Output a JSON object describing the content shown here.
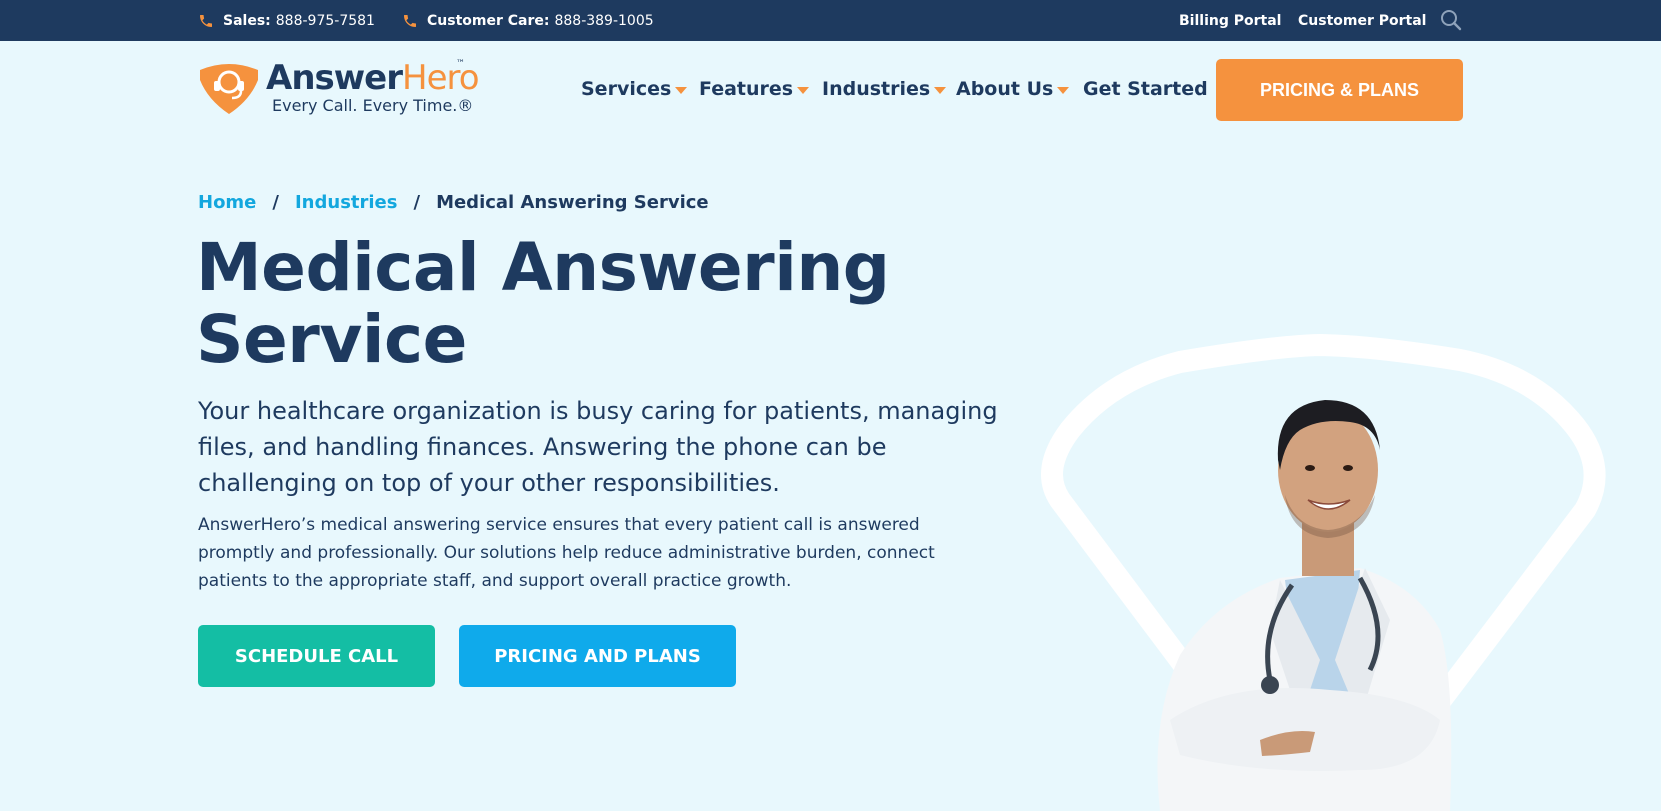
{
  "topbar": {
    "sales_label": "Sales:",
    "sales_number": "888-975-7581",
    "care_label": "Customer Care:",
    "care_number": "888-389-1005",
    "billing_portal": "Billing Portal",
    "customer_portal": "Customer Portal"
  },
  "logo": {
    "brand_main": "Answer",
    "brand_accent": "Hero",
    "trademark": "™",
    "tagline": "Every Call. Every Time.®"
  },
  "nav": {
    "items": [
      {
        "label": "Services"
      },
      {
        "label": "Features"
      },
      {
        "label": "Industries"
      },
      {
        "label": "About Us"
      },
      {
        "label": "Get Started"
      }
    ],
    "pricing_button": "PRICING & PLANS"
  },
  "breadcrumb": {
    "home": "Home",
    "industries": "Industries",
    "current": "Medical Answering Service",
    "separator": "/"
  },
  "hero": {
    "title_line1": "Medical Answering",
    "title_line2": "Service",
    "lead": "Your healthcare organization is busy caring for patients, managing files, and handling finances. Answering the phone can be challenging on top of your other responsibilities.",
    "body": "AnswerHero’s medical answering service ensures that every patient call is answered promptly and professionally. Our solutions help reduce administrative burden, connect patients to the appropriate staff, and support overall practice growth.",
    "schedule_button": "SCHEDULE CALL",
    "pricing_button": "PRICING AND PLANS"
  },
  "colors": {
    "navy": "#1e3a5f",
    "orange": "#f5923e",
    "teal": "#14bea4",
    "blue": "#0faaeb",
    "background": "#e8f8fd"
  },
  "icons": {
    "phone": "phone-icon",
    "search": "search-icon",
    "logo": "headset-shield-icon",
    "caret": "caret-down-icon"
  }
}
